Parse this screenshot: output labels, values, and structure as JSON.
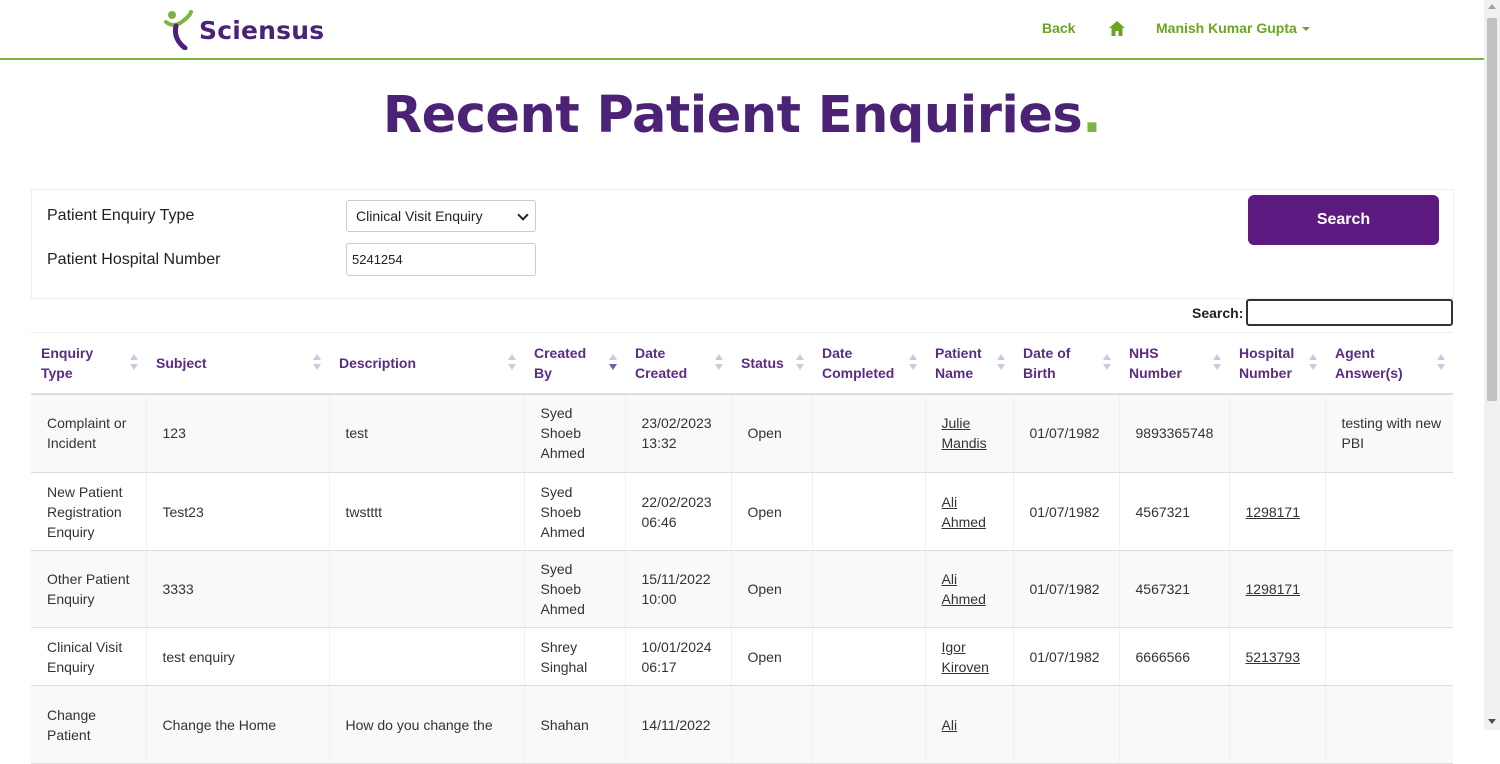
{
  "header": {
    "logo_text": "Sciensus",
    "back_label": "Back",
    "user_name": "Manish Kumar Gupta",
    "brand_purple": "#4b2275",
    "brand_green": "#7cb342"
  },
  "page": {
    "title": "Recent Patient Enquiries",
    "title_dot": "."
  },
  "filters": {
    "enquiry_type_label": "Patient Enquiry Type",
    "enquiry_type_value": "Clinical Visit Enquiry",
    "hospital_number_label": "Patient Hospital Number",
    "hospital_number_value": "5241254",
    "search_button": "Search"
  },
  "table_search": {
    "label": "Search:",
    "value": ""
  },
  "table": {
    "columns": [
      "Enquiry Type",
      "Subject",
      "Description",
      "Created By",
      "Date Created",
      "Status",
      "Date Completed",
      "Patient Name",
      "Date of Birth",
      "NHS Number",
      "Hospital Number",
      "Agent Answer(s)"
    ],
    "sorted_column": "Created By",
    "sort_direction": "descending",
    "rows": [
      [
        "Complaint or Incident",
        "123",
        "test",
        "Syed Shoeb Ahmed",
        "23/02/2023 13:32",
        "Open",
        "",
        "Julie Mandis",
        "01/07/1982",
        "9893365748",
        "",
        "testing with new PBI"
      ],
      [
        "New Patient Registration Enquiry",
        "Test23",
        "twstttt",
        "Syed Shoeb Ahmed",
        "22/02/2023 06:46",
        "Open",
        "",
        "Ali Ahmed",
        "01/07/1982",
        "4567321",
        "1298171",
        ""
      ],
      [
        "Other Patient Enquiry",
        "3333",
        "",
        "Syed Shoeb Ahmed",
        "15/11/2022 10:00",
        "Open",
        "",
        "Ali Ahmed",
        "01/07/1982",
        "4567321",
        "1298171",
        ""
      ],
      [
        "Clinical Visit Enquiry",
        "test enquiry",
        "",
        "Shrey Singhal",
        "10/01/2024 06:17",
        "Open",
        "",
        "Igor Kiroven",
        "01/07/1982",
        "6666566",
        "5213793",
        ""
      ],
      [
        "Change Patient",
        "Change the Home",
        "How do you change the",
        "Shahan",
        "14/11/2022",
        "",
        "",
        "Ali",
        "",
        "",
        "",
        ""
      ]
    ]
  }
}
